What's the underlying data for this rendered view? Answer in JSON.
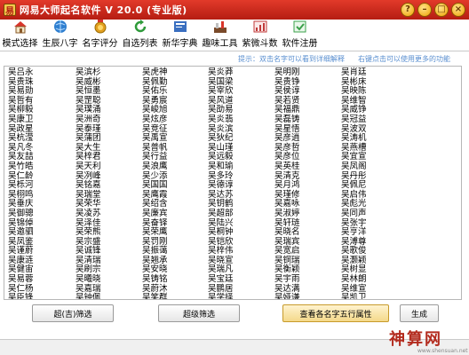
{
  "window": {
    "title": "网易大师起名软件 V 20.0 (专业版)",
    "buttons": [
      "?",
      "–",
      "□",
      "×"
    ]
  },
  "toolbar": [
    {
      "label": "模式选择",
      "icon": "house-icon",
      "color": "#d9352b"
    },
    {
      "label": "生辰八字",
      "icon": "globe-icon",
      "color": "#2f7fd0"
    },
    {
      "label": "名字评分",
      "icon": "medal-icon",
      "color": "#e2a020"
    },
    {
      "label": "自选列表",
      "icon": "refresh-icon",
      "color": "#2f9a3a"
    },
    {
      "label": "新华字典",
      "icon": "dictionary-icon",
      "color": "#3a6fc0"
    },
    {
      "label": "趣味工具",
      "icon": "tools-icon",
      "color": "#7a4a2a"
    },
    {
      "label": "紫微斗数",
      "icon": "chart-icon",
      "color": "#c03a3a"
    },
    {
      "label": "软件注册",
      "icon": "register-icon",
      "color": "#3aa04a"
    }
  ],
  "hints": {
    "left": "提示：双击名字可以看到详细解释",
    "right": "右键点击可以使用更多的功能"
  },
  "names_columns": [
    [
      "吴吕永",
      "吴贵珠",
      "吴易勋",
      "吴哲有",
      "吴柳毅",
      "吴康卫",
      "吴政星",
      "吴杭滢",
      "吴凡冬",
      "吴友喆",
      "吴竹皓",
      "吴仁龄",
      "吴栎河",
      "吴栩鸣",
      "吴垂庆",
      "吴御骢",
      "吴锦倬",
      "吴邀驷",
      "吴凤鉴",
      "吴谨蔚",
      "吴康涟",
      "吴健宙",
      "吴易蓉",
      "吴仁杨",
      "吴臣锋",
      "吴柏嵩"
    ],
    [
      "吴滨杉",
      "吴威彬",
      "吴恒墨",
      "吴罡聪",
      "吴璞涌",
      "吴洲奇",
      "吴泰瑾",
      "吴蒲团",
      "吴大生",
      "吴梓君",
      "吴天利",
      "吴冽峰",
      "吴铭嘉",
      "吴瑞堂",
      "吴荣华",
      "吴凌苏",
      "吴泽佳",
      "吴荣熊",
      "吴宗盛",
      "吴诚锋",
      "吴清瑞",
      "吴刷宗",
      "吴曦晓",
      "吴嘉瑞",
      "吴钟佩",
      "吴皓常",
      "吴悦涌"
    ],
    [
      "吴虎神",
      "吴佩勤",
      "吴佑乐",
      "吴勇宸",
      "吴峻旭",
      "吴炫彦",
      "吴竞征",
      "吴禹宣",
      "吴普帆",
      "吴行益",
      "吴浪鹰",
      "吴少添",
      "吴国国",
      "吴鹰霞",
      "吴绍含",
      "吴廉宾",
      "吴奋铎",
      "吴荣鹰",
      "吴罚刚",
      "吴振蔼",
      "吴翘承",
      "吴安晓",
      "吴铸铭",
      "吴蔚沐",
      "吴笑群",
      "吴勋普"
    ],
    [
      "吴炎莽",
      "吴国梁",
      "吴宰欣",
      "吴风道",
      "吴劭易",
      "吴炎翡",
      "吴炎滨",
      "吴狄纪",
      "吴山瑾",
      "吴远毅",
      "吴和瑜",
      "吴多玲",
      "吴德谆",
      "吴达苏",
      "吴钥鹤",
      "吴超部",
      "吴陆兴",
      "吴桐钟",
      "吴铠欣",
      "吴梓伟",
      "吴晓宣",
      "吴瑞凡",
      "吴宝廷",
      "吴鹏居",
      "吴学择",
      "吴颖甫"
    ],
    [
      "吴明刚",
      "吴贵铮",
      "吴侯谆",
      "吴若贤",
      "吴福鼎",
      "吴磊铸",
      "吴星悟",
      "吴彦逍",
      "吴彦哲",
      "吴彦位",
      "吴英桂",
      "吴清克",
      "吴月鸿",
      "吴瑾修",
      "吴嘉咏",
      "吴淑婷",
      "吴轩琏",
      "吴晓名",
      "吴瑞宾",
      "吴宽启",
      "吴铜瑞",
      "吴衡颖",
      "吴宇雨",
      "吴达满",
      "吴娅谦",
      "吴文灵"
    ],
    [
      "吴肖廷",
      "吴彬床",
      "吴映陈",
      "吴维智",
      "吴威铮",
      "吴冠益",
      "吴波双",
      "吴涛机",
      "吴燕槽",
      "吴宜宣",
      "吴凤阁",
      "吴丹彤",
      "吴佩尼",
      "吴启伟",
      "吴彪光",
      "吴同声",
      "吴张宇",
      "吴亨洋",
      "吴溥尊",
      "吴歌俊",
      "吴灏颖",
      "吴树显",
      "吴林朗",
      "吴维宣",
      "吴凯卫",
      "吴孙苏",
      "吴耀熏",
      "吴学堤"
    ]
  ],
  "actions": {
    "fortune_filter": "超(吉)筛选",
    "super_filter": "超级筛选",
    "wuxing_view": "查看各名字五行属性",
    "generate": "生成"
  },
  "watermark": {
    "text": "神算网",
    "domain": "www.shensuan.net"
  }
}
